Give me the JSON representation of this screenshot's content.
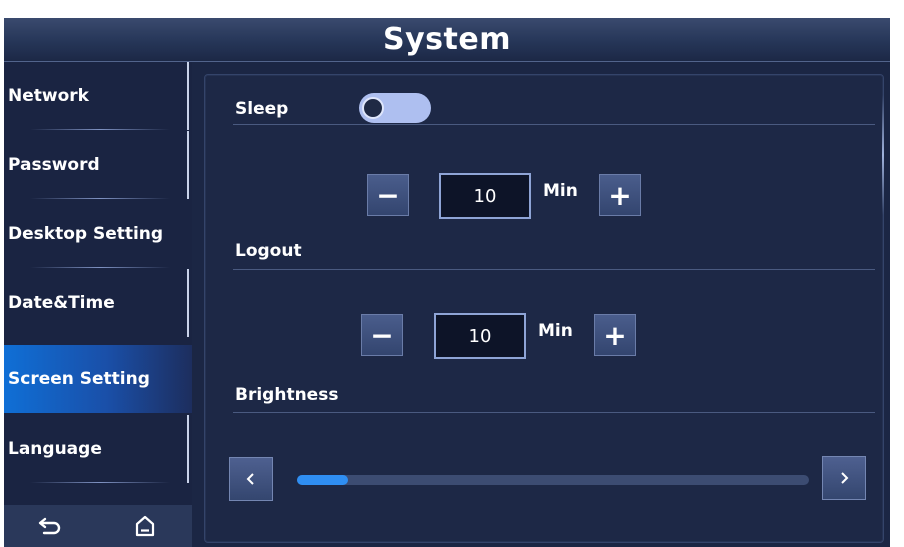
{
  "window": {
    "title": "System"
  },
  "sidebar": {
    "items": [
      {
        "label": "Network"
      },
      {
        "label": "Password"
      },
      {
        "label": "Desktop Setting"
      },
      {
        "label": "Date&Time"
      },
      {
        "label": "Screen Setting",
        "active": true
      },
      {
        "label": "Language"
      }
    ],
    "bottom_icons": [
      "back-icon",
      "home-icon"
    ]
  },
  "screen_setting": {
    "sleep": {
      "label": "Sleep",
      "toggle_on": false,
      "value": "10",
      "unit": "Min"
    },
    "logout": {
      "label": "Logout",
      "value": "10",
      "unit": "Min"
    },
    "brightness": {
      "label": "Brightness",
      "level": 0.1
    }
  },
  "icons": {
    "minus": "−",
    "plus": "+"
  },
  "colors": {
    "accent": "#2f8ef2",
    "active_tab": "#0f6fd6",
    "background": "#1b2644"
  }
}
